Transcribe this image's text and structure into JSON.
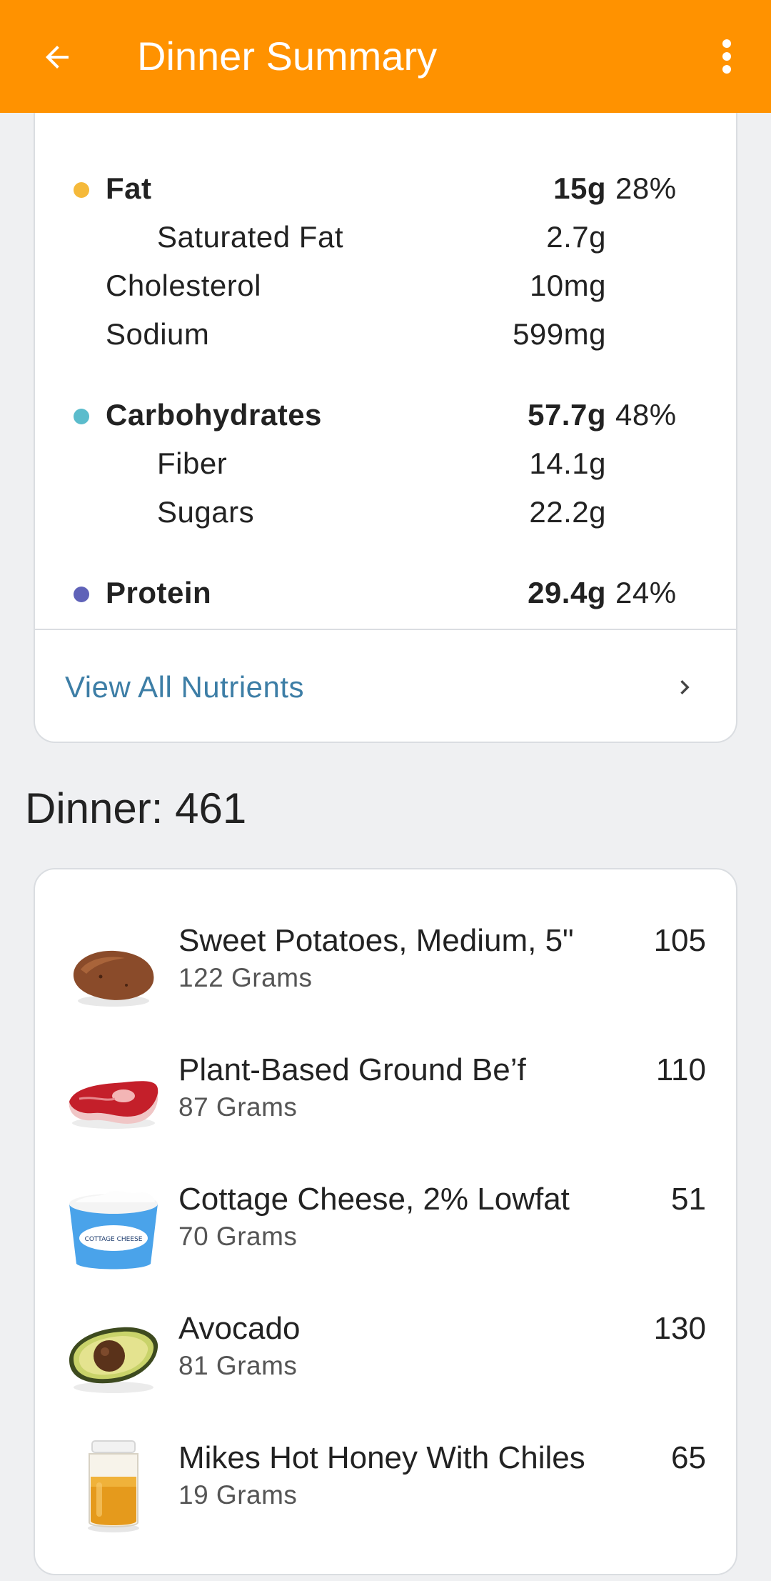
{
  "app_bar": {
    "title": "Dinner Summary",
    "back_icon": "arrow-left-icon",
    "menu_icon": "more-vert-icon",
    "background": "#ff9200"
  },
  "nutrients": {
    "fat": {
      "name": "Fat",
      "amount": "15g",
      "percent": "28%",
      "color": "#f5b93a"
    },
    "saturated_fat": {
      "name": "Saturated Fat",
      "amount": "2.7g"
    },
    "cholesterol": {
      "name": "Cholesterol",
      "amount": "10mg"
    },
    "sodium": {
      "name": "Sodium",
      "amount": "599mg"
    },
    "carbohydrates": {
      "name": "Carbohydrates",
      "amount": "57.7g",
      "percent": "48%",
      "color": "#5bbccc"
    },
    "fiber": {
      "name": "Fiber",
      "amount": "14.1g"
    },
    "sugars": {
      "name": "Sugars",
      "amount": "22.2g"
    },
    "protein": {
      "name": "Protein",
      "amount": "29.4g",
      "percent": "24%",
      "color": "#5f62b8"
    },
    "view_all_label": "View All Nutrients",
    "view_all_icon": "chevron-right-icon"
  },
  "dinner": {
    "title": "Dinner: 461",
    "foods": [
      {
        "name": "Sweet Potatoes, Medium, 5\"",
        "quantity": "122 Grams",
        "calories": "105",
        "icon": "sweet-potato-icon"
      },
      {
        "name": "Plant-Based Ground Be’f",
        "quantity": "87 Grams",
        "calories": "110",
        "icon": "steak-icon"
      },
      {
        "name": "Cottage Cheese, 2% Lowfat",
        "quantity": "70 Grams",
        "calories": "51",
        "icon": "cottage-cheese-icon",
        "label_text": "COTTAGE CHEESE"
      },
      {
        "name": "Avocado",
        "quantity": "81 Grams",
        "calories": "130",
        "icon": "avocado-icon"
      },
      {
        "name": "Mikes Hot Honey With Chiles",
        "quantity": "19 Grams",
        "calories": "65",
        "icon": "honey-jar-icon"
      }
    ]
  }
}
